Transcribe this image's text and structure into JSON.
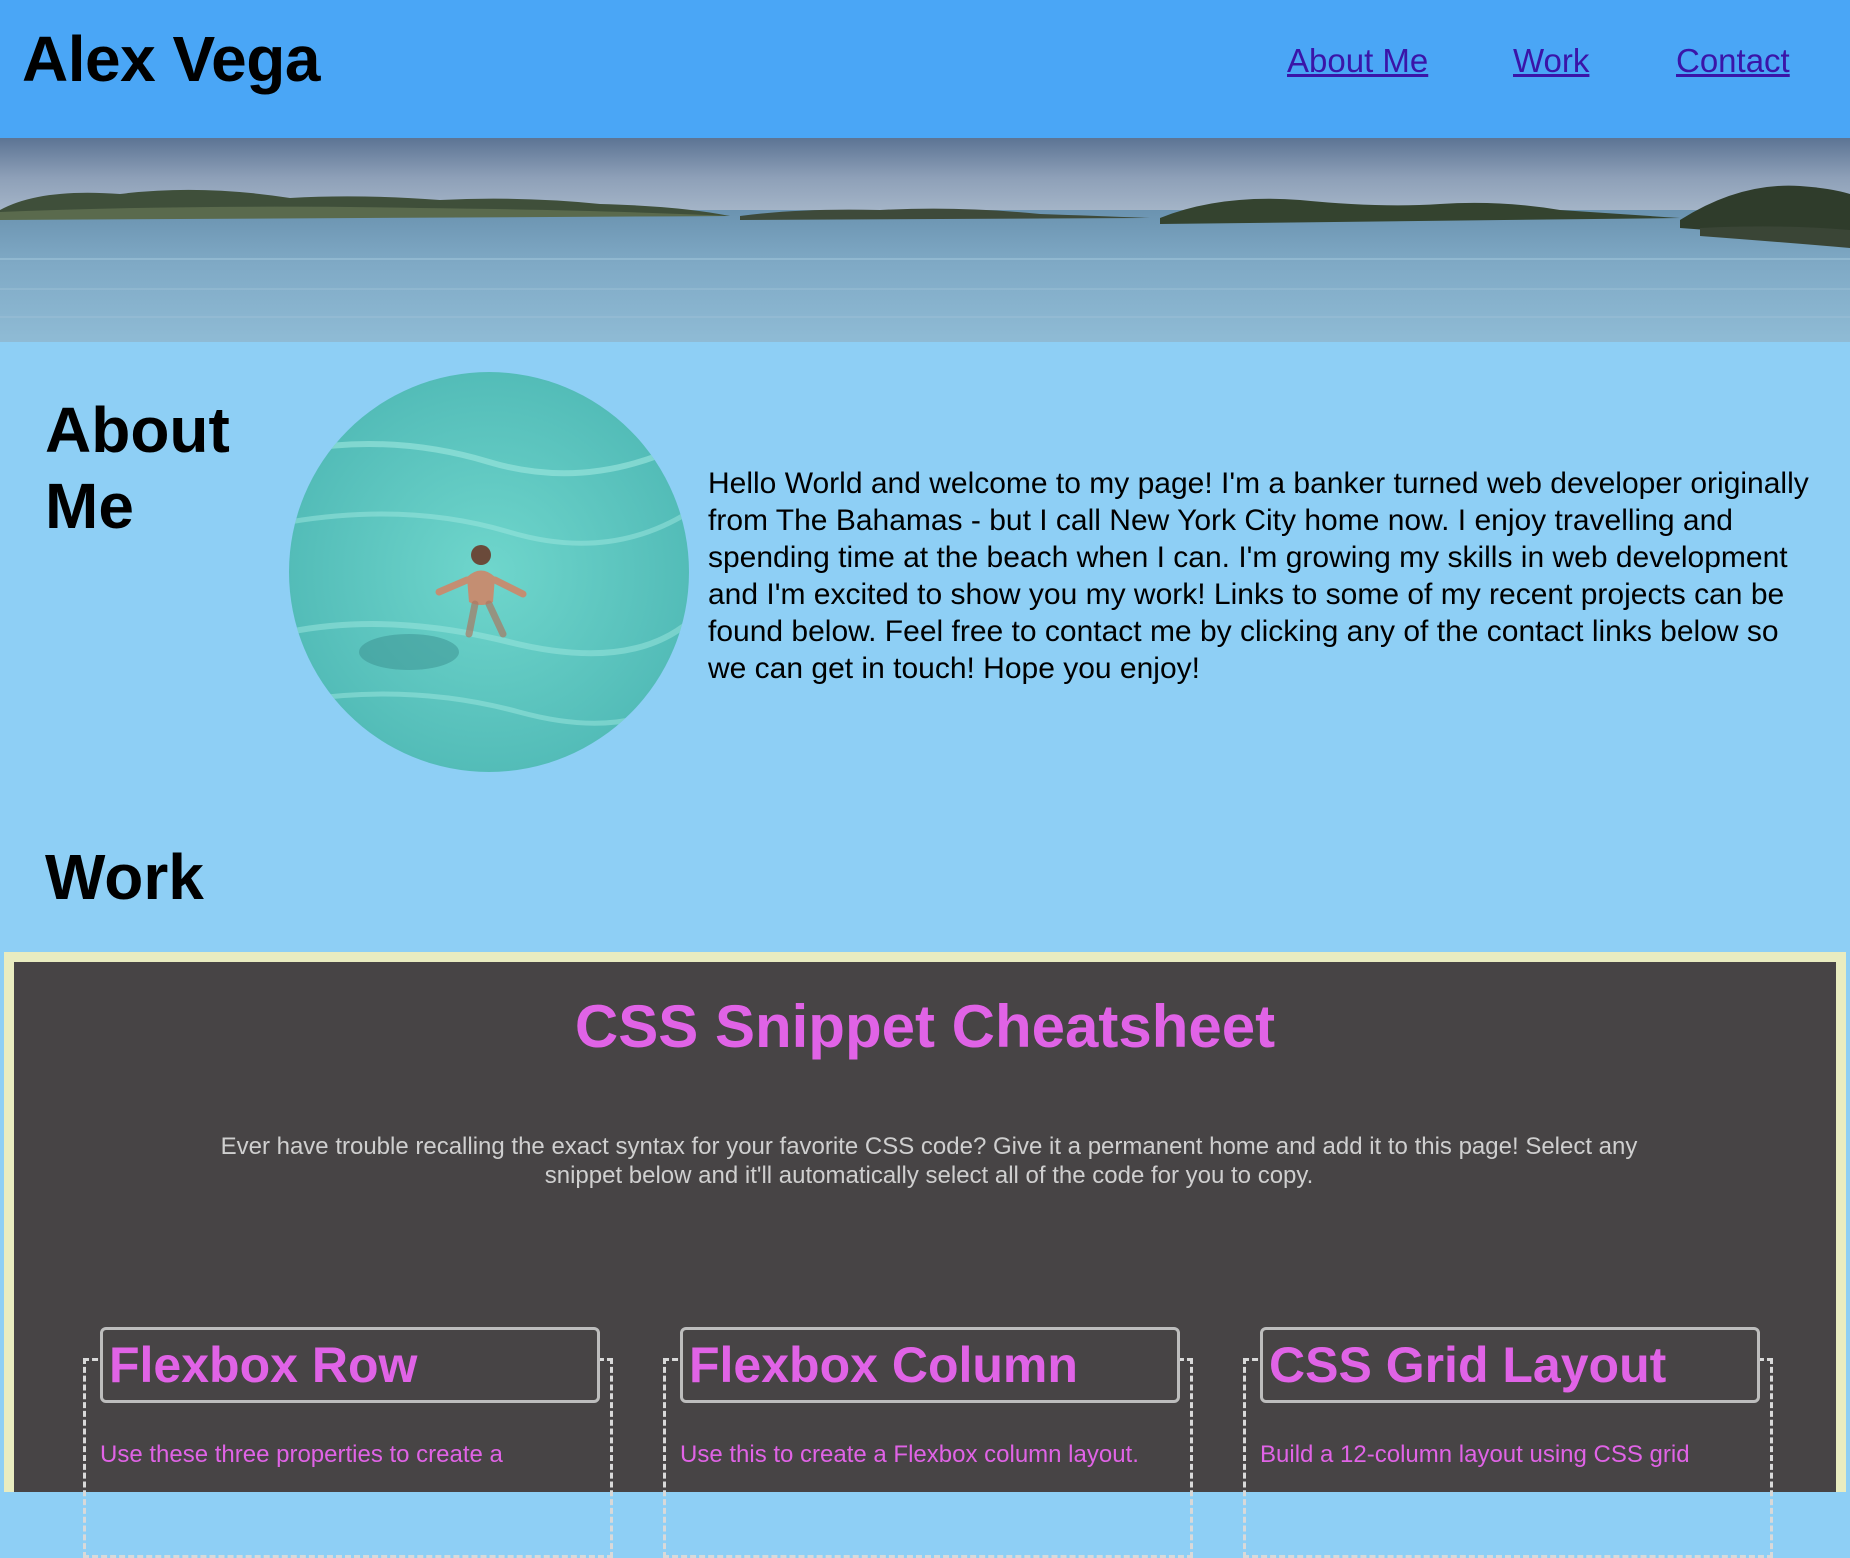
{
  "header": {
    "title": "Alex Vega",
    "nav": [
      {
        "label": "About Me"
      },
      {
        "label": "Work"
      },
      {
        "label": "Contact"
      }
    ]
  },
  "about": {
    "heading": "About Me",
    "text": "Hello World and welcome to my page! I'm a banker turned web developer originally from The Bahamas - but I call New York City home now. I enjoy travelling and spending time at the beach when I can. I'm growing my skills in web development and I'm excited to show you my work! Links to some of my recent projects can be found below. Feel free to contact me by clicking any of the contact links below so we can get in touch! Hope you enjoy!"
  },
  "work": {
    "heading": "Work",
    "project": {
      "title": "CSS Snippet Cheatsheet",
      "description": "Ever have trouble recalling the exact syntax for your favorite CSS code? Give it a permanent home and add it to this page! Select any snippet below and it'll automatically select all of the code for you to copy.",
      "cards": [
        {
          "title": "Flexbox Row",
          "text": "Use these three properties to create a"
        },
        {
          "title": "Flexbox Column",
          "text": "Use this to create a Flexbox column layout."
        },
        {
          "title": "CSS Grid Layout",
          "text": "Build a 12-column layout using CSS grid"
        }
      ]
    }
  },
  "colors": {
    "header_bg": "#4aa6f6",
    "page_bg": "#8ecff5",
    "nav_link": "#3a15a8",
    "project_bg": "#474445",
    "project_accent": "#e063e6",
    "project_border": "#e9ecc0"
  },
  "images": {
    "hero": "ocean-islands-banner",
    "portrait": "swimmer-in-turquoise-water"
  }
}
